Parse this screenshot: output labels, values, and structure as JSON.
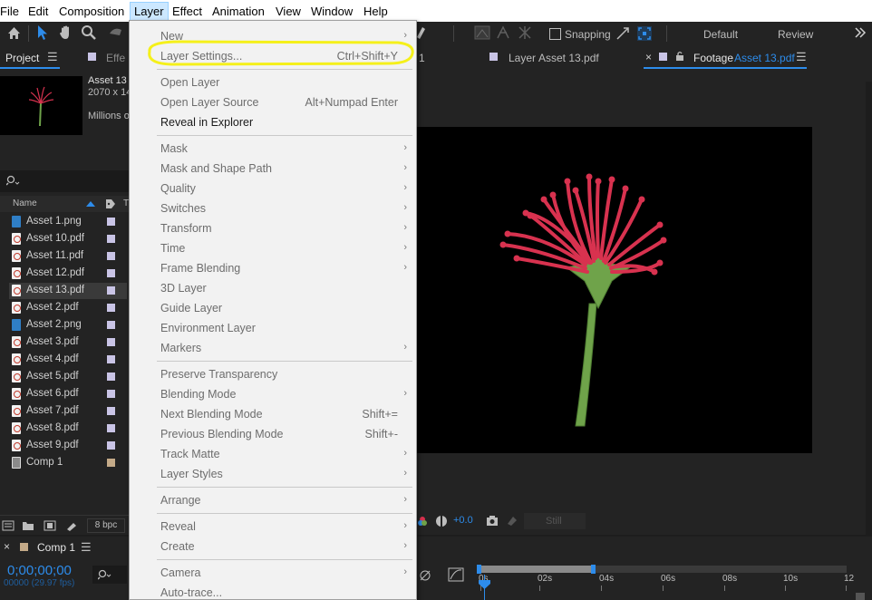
{
  "menubar": {
    "items": [
      "File",
      "Edit",
      "Composition",
      "Layer",
      "Effect",
      "Animation",
      "View",
      "Window",
      "Help"
    ]
  },
  "toolbar": {
    "snapping_label": "Snapping",
    "workspaces": [
      "Default",
      "Review"
    ]
  },
  "project_panel": {
    "tab_label": "Project",
    "effects_tab_partial": "Effe",
    "asset_name": "Asset 13",
    "asset_dims": "2070 x 14",
    "asset_color": "Millions o",
    "search_icon": "search-icon",
    "col_name": "Name",
    "bpc_label": "8 bpc",
    "files": [
      {
        "name": "Asset 1.png",
        "type": "png"
      },
      {
        "name": "Asset 10.pdf",
        "type": "pdf"
      },
      {
        "name": "Asset 11.pdf",
        "type": "pdf"
      },
      {
        "name": "Asset 12.pdf",
        "type": "pdf"
      },
      {
        "name": "Asset 13.pdf",
        "type": "pdf",
        "selected": true
      },
      {
        "name": "Asset 2.pdf",
        "type": "pdf"
      },
      {
        "name": "Asset 2.png",
        "type": "png"
      },
      {
        "name": "Asset 3.pdf",
        "type": "pdf"
      },
      {
        "name": "Asset 4.pdf",
        "type": "pdf"
      },
      {
        "name": "Asset 5.pdf",
        "type": "pdf"
      },
      {
        "name": "Asset 6.pdf",
        "type": "pdf"
      },
      {
        "name": "Asset 7.pdf",
        "type": "pdf"
      },
      {
        "name": "Asset 8.pdf",
        "type": "pdf"
      },
      {
        "name": "Asset 9.pdf",
        "type": "pdf"
      },
      {
        "name": "Comp 1",
        "type": "comp"
      }
    ]
  },
  "viewer": {
    "tab_partial": "1",
    "layer_tab_prefix": "Layer",
    "layer_tab_name": "Asset 13.pdf",
    "footage_tab_prefix": "Footage",
    "footage_tab_name": "Asset 13.pdf",
    "exposure": "+0.0",
    "still_label": "Still"
  },
  "timeline": {
    "comp_tab": "Comp 1",
    "timecode": "0;00;00;00",
    "frame_info": "00000 (29.97 fps)",
    "ruler_labels": [
      "0s",
      "02s",
      "04s",
      "06s",
      "08s",
      "10s",
      "12"
    ]
  },
  "layer_menu": {
    "items": [
      {
        "label": "New",
        "disabled": true,
        "arrow": true
      },
      {
        "label": "Layer Settings...",
        "shortcut": "Ctrl+Shift+Y",
        "disabled": true
      },
      {
        "sep": true
      },
      {
        "label": "Open Layer",
        "disabled": true
      },
      {
        "label": "Open Layer Source",
        "shortcut": "Alt+Numpad Enter",
        "disabled": true
      },
      {
        "label": "Reveal in Explorer"
      },
      {
        "sep": true
      },
      {
        "label": "Mask",
        "disabled": true,
        "arrow": true
      },
      {
        "label": "Mask and Shape Path",
        "disabled": true,
        "arrow": true
      },
      {
        "label": "Quality",
        "disabled": true,
        "arrow": true
      },
      {
        "label": "Switches",
        "disabled": true,
        "arrow": true
      },
      {
        "label": "Transform",
        "disabled": true,
        "arrow": true
      },
      {
        "label": "Time",
        "disabled": true,
        "arrow": true
      },
      {
        "label": "Frame Blending",
        "disabled": true,
        "arrow": true
      },
      {
        "label": "3D Layer",
        "disabled": true
      },
      {
        "label": "Guide Layer",
        "disabled": true
      },
      {
        "label": "Environment Layer",
        "disabled": true
      },
      {
        "label": "Markers",
        "disabled": true,
        "arrow": true
      },
      {
        "sep": true
      },
      {
        "label": "Preserve Transparency",
        "disabled": true
      },
      {
        "label": "Blending Mode",
        "disabled": true,
        "arrow": true
      },
      {
        "label": "Next Blending Mode",
        "shortcut": "Shift+=",
        "disabled": true
      },
      {
        "label": "Previous Blending Mode",
        "shortcut": "Shift+-",
        "disabled": true
      },
      {
        "label": "Track Matte",
        "disabled": true,
        "arrow": true
      },
      {
        "label": "Layer Styles",
        "disabled": true,
        "arrow": true
      },
      {
        "sep": true
      },
      {
        "label": "Arrange",
        "disabled": true,
        "arrow": true
      },
      {
        "sep": true
      },
      {
        "label": "Reveal",
        "disabled": true,
        "arrow": true
      },
      {
        "label": "Create",
        "disabled": true,
        "arrow": true
      },
      {
        "sep": true
      },
      {
        "label": "Camera",
        "disabled": true,
        "arrow": true
      },
      {
        "label": "Auto-trace...",
        "disabled": true
      }
    ]
  },
  "colors": {
    "highlight_circle": "#f5f01a",
    "accent_blue": "#2d8ceb",
    "flower_red": "#d8324f",
    "stem_green": "#6fa34a"
  }
}
